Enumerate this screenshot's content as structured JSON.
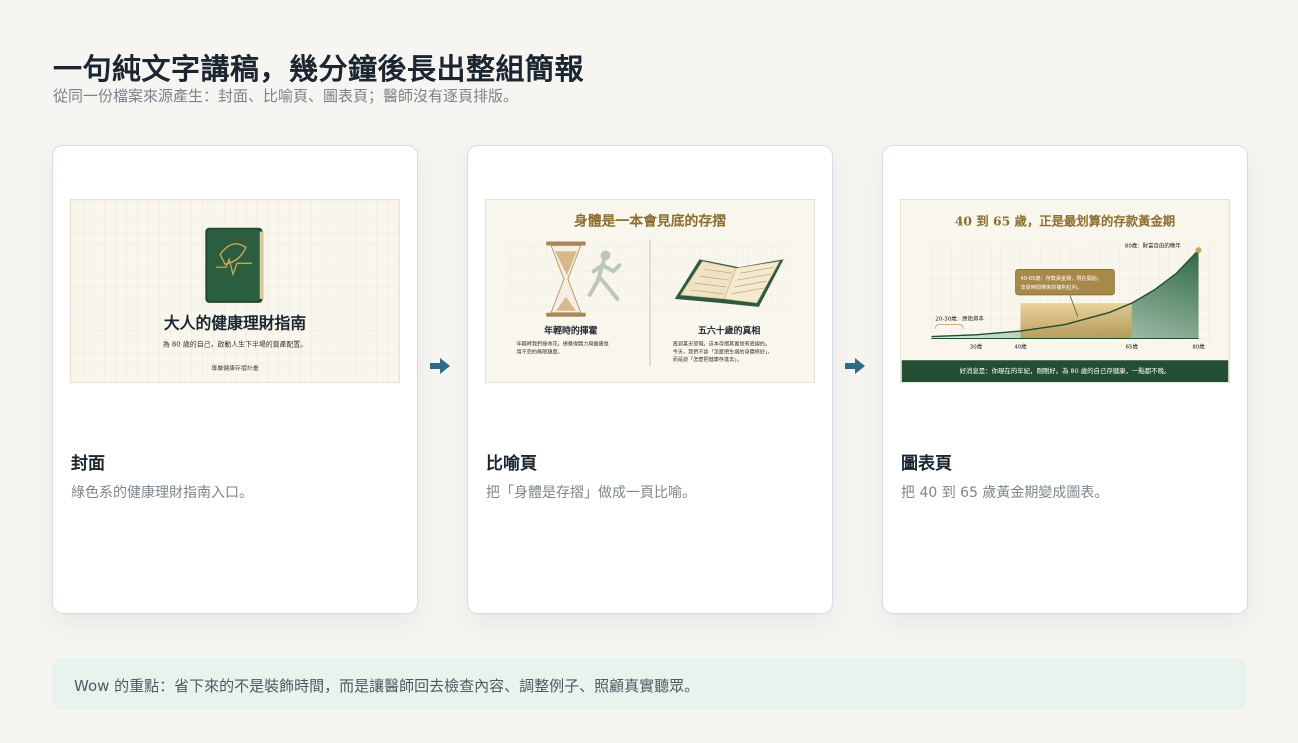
{
  "header": {
    "title": "一句純文字講稿，幾分鐘後長出整組簡報",
    "subtitle": "從同一份檔案來源產生：封面、比喻頁、圖表頁；醫師沒有逐頁排版。"
  },
  "cards": [
    {
      "label": "封面",
      "desc": "綠色系的健康理財指南入口。",
      "slide": {
        "title": "大人的健康理財指南",
        "subtitle": "為 80 歲的自己，啟動人生下半場的資產配置。",
        "footer": "專屬健康存摺計畫"
      }
    },
    {
      "label": "比喻頁",
      "desc": "把「身體是存摺」做成一頁比喻。",
      "slide": {
        "title": "身體是一本會見底的存摺",
        "left_heading": "年輕時的揮霍",
        "left_text": [
          "年輕時我們揮命花，總覺得體力與健康是",
          "用不完的無限額度。"
        ],
        "right_heading": "五六十歲的真相",
        "right_text": [
          "直到某天發現，這本存摺其實是有底線的。",
          "今天，我們不談「怎麼把生病的身體修好」，",
          "而是談「怎麼把健康存進去」。"
        ]
      }
    },
    {
      "label": "圖表頁",
      "desc": "把 40 到 65 歲黃金期變成圖表。",
      "slide": {
        "title": "40 到 65 歲，正是最划算的存款黃金期",
        "callout_top": "80歲：財富自由的晚年",
        "callout_mid": [
          "40-65歲：存款黃金期，現在開始，",
          "享受時間帶來的複利紅利。"
        ],
        "callout_low": "20-30歲：原始資本",
        "footer": "好消息是：你現在的年紀，剛剛好。為 80 歲的自己存健康，一點都不晚。"
      }
    }
  ],
  "chart_data": {
    "type": "area",
    "title": "40 到 65 歲，正是最划算的存款黃金期",
    "x_ticks": [
      "30歲",
      "40歲",
      "65歲",
      "80歲"
    ],
    "x": [
      20,
      30,
      40,
      50,
      60,
      65,
      70,
      75,
      80
    ],
    "y": [
      2,
      4,
      8,
      15,
      28,
      38,
      52,
      70,
      95
    ],
    "highlight_range": [
      40,
      65
    ],
    "ylim": [
      0,
      100
    ],
    "grid": true,
    "colors": {
      "fill": "#2f6a46",
      "highlight": "#c9a85c",
      "line": "#1f4d33"
    }
  },
  "note": {
    "text": "Wow 的重點：省下來的不是裝飾時間，而是讓醫師回去檢查內容、調整例子、照顧真實聽眾。"
  },
  "colors": {
    "accent_green": "#2e5f3e",
    "arrow": "#2d6b86",
    "gold": "#b9974f"
  }
}
